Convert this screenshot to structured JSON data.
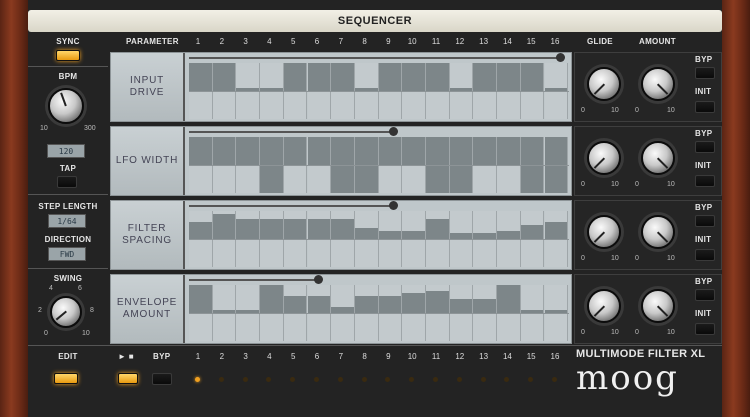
{
  "title": "SEQUENCER",
  "left": {
    "sync": "SYNC",
    "bpm": "BPM",
    "bpm_value": "120",
    "tap": "TAP",
    "bpm_min": "10",
    "bpm_max": "300",
    "step_length": "STEP LENGTH",
    "step_length_value": "1/64",
    "direction": "DIRECTION",
    "direction_value": "FWD",
    "swing": "SWING",
    "swing_ticks": [
      "0",
      "2",
      "4",
      "6",
      "8",
      "10"
    ]
  },
  "header": {
    "parameter": "PARAMETER",
    "glide": "GLIDE",
    "amount": "AMOUNT",
    "steps": [
      "1",
      "2",
      "3",
      "4",
      "5",
      "6",
      "7",
      "8",
      "9",
      "10",
      "11",
      "12",
      "13",
      "14",
      "15",
      "16"
    ]
  },
  "rows": [
    {
      "name": "INPUT\nDRIVE",
      "byp": "BYP",
      "init": "INIT",
      "scale_a": "0",
      "scale_b": "10",
      "slider": 1.0,
      "steps": [
        0.5,
        0.5,
        0.05,
        0.05,
        0.5,
        0.5,
        0.5,
        0.05,
        0.5,
        0.5,
        0.5,
        0.05,
        0.5,
        0.5,
        0.5,
        0.05
      ]
    },
    {
      "name": "LFO WIDTH",
      "byp": "BYP",
      "init": "INIT",
      "scale_a": "0",
      "scale_b": "10",
      "slider": 0.55,
      "steps": [
        0.5,
        0.5,
        0.6,
        0.9,
        0.5,
        0.5,
        0.9,
        0.9,
        0.5,
        0.5,
        0.9,
        0.9,
        0.5,
        0.5,
        0.9,
        0.9
      ]
    },
    {
      "name": "FILTER\nSPACING",
      "byp": "BYP",
      "init": "INIT",
      "scale_a": "0",
      "scale_b": "10",
      "slider": 0.55,
      "steps": [
        0.3,
        0.45,
        0.35,
        0.35,
        0.35,
        0.35,
        0.35,
        0.2,
        0.15,
        0.15,
        0.35,
        0.1,
        0.1,
        0.15,
        0.25,
        0.3
      ]
    },
    {
      "name": "ENVELOPE\nAMOUNT",
      "byp": "BYP",
      "init": "INIT",
      "scale_a": "0",
      "scale_b": "10",
      "slider": 0.35,
      "steps": [
        0.5,
        0.05,
        0.05,
        0.5,
        0.3,
        0.3,
        0.1,
        0.3,
        0.3,
        0.35,
        0.4,
        0.25,
        0.25,
        0.5,
        0.05,
        0.05
      ]
    }
  ],
  "bottom": {
    "edit": "EDIT",
    "play": "► ■",
    "byp": "BYP",
    "active_step": 1,
    "steps": [
      "1",
      "2",
      "3",
      "4",
      "5",
      "6",
      "7",
      "8",
      "9",
      "10",
      "11",
      "12",
      "13",
      "14",
      "15",
      "16"
    ]
  },
  "brand": {
    "product": "MULTIMODE FILTER XL",
    "logo": "moog"
  }
}
